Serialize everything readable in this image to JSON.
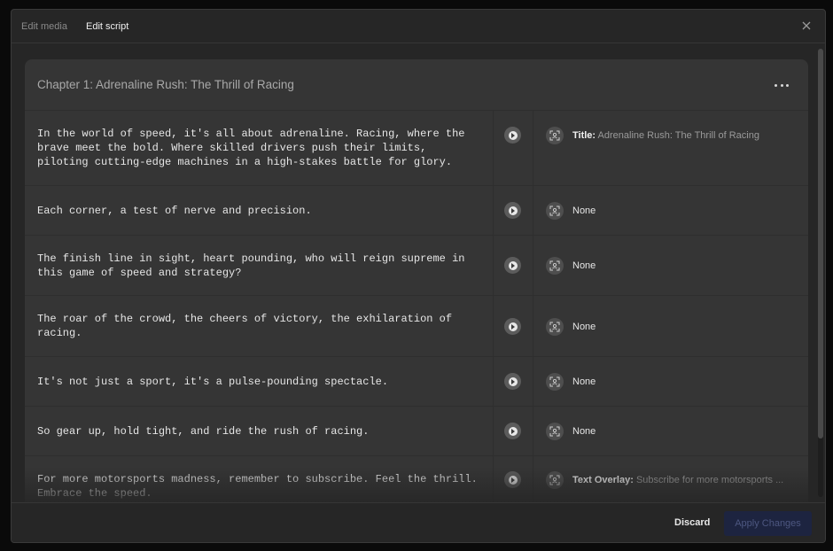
{
  "tabs": [
    {
      "label": "Edit media",
      "active": false
    },
    {
      "label": "Edit script",
      "active": true
    }
  ],
  "chapter": {
    "title": "Chapter 1: Adrenaline Rush: The Thrill of Racing"
  },
  "rows": [
    {
      "text": "In the world of speed, it's all about adrenaline. Racing, where the brave meet the bold. Where skilled drivers push their limits, piloting cutting-edge machines in a high-stakes battle for glory.",
      "media_label": "Title:",
      "media_value": "Adrenaline Rush: The Thrill of Racing"
    },
    {
      "text": "Each corner, a test of nerve and precision.",
      "media_label": "",
      "media_value": "None"
    },
    {
      "text": "The finish line in sight, heart pounding, who will reign supreme in this game of speed and strategy?",
      "media_label": "",
      "media_value": "None"
    },
    {
      "text": "The roar of the crowd, the cheers of victory, the exhilaration of racing.",
      "media_label": "",
      "media_value": "None"
    },
    {
      "text": "It's not just a sport, it's a pulse-pounding spectacle.",
      "media_label": "",
      "media_value": "None"
    },
    {
      "text": "So gear up, hold tight, and ride the rush of racing.",
      "media_label": "",
      "media_value": "None"
    },
    {
      "text": "For more motorsports madness, remember to subscribe. Feel the thrill. Embrace the speed.",
      "media_label": "Text Overlay:",
      "media_value": "Subscribe for more motorsports ..."
    }
  ],
  "footer": {
    "discard_label": "Discard",
    "apply_label": "Apply Changes"
  },
  "colors": {
    "background": "#262626",
    "card": "#353535",
    "apply_button": "#1d2440"
  },
  "icons": {
    "close": "close-icon",
    "more": "more-horizontal-icon",
    "play": "play-icon",
    "media": "scan-media-icon"
  }
}
